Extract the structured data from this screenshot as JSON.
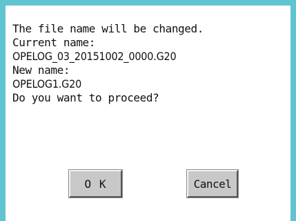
{
  "dialog": {
    "lines": [
      "The file name will be changed.",
      "Current name:",
      "OPELOG_03_20151002_0000.G20",
      "New name:",
      "OPELOG1.G20",
      "Do you want to proceed?"
    ],
    "ok_label": "O K",
    "cancel_label": "Cancel"
  },
  "colors": {
    "frame": "#5fc4cf",
    "button_face": "#c8c8c8"
  }
}
